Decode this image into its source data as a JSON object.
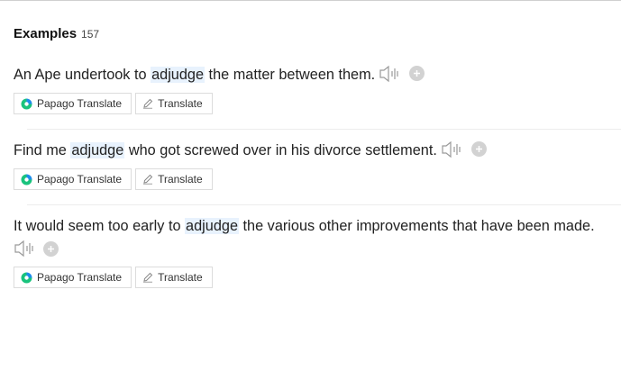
{
  "section": {
    "title": "Examples",
    "count": "157"
  },
  "examples": [
    {
      "before": "An Ape undertook to ",
      "keyword": "adjudge",
      "after": " the matter between them."
    },
    {
      "before": "Find me ",
      "keyword": "adjudge",
      "after": " who got screwed over in his divorce settlement."
    },
    {
      "before": "It would seem too early to ",
      "keyword": "adjudge",
      "after": " the various other improvements that have been made."
    }
  ],
  "buttons": {
    "papago": "Papago Translate",
    "translate": "Translate"
  },
  "icons": {
    "speaker": "speaker-icon",
    "add": "plus-circle-icon",
    "papago": "papago-logo-icon",
    "pencil": "pencil-icon"
  },
  "colors": {
    "highlight": "#e8f2fd",
    "icon_gray": "#9a9a9a",
    "papago_green": "#19c37d",
    "papago_blue": "#1f8ceb"
  }
}
